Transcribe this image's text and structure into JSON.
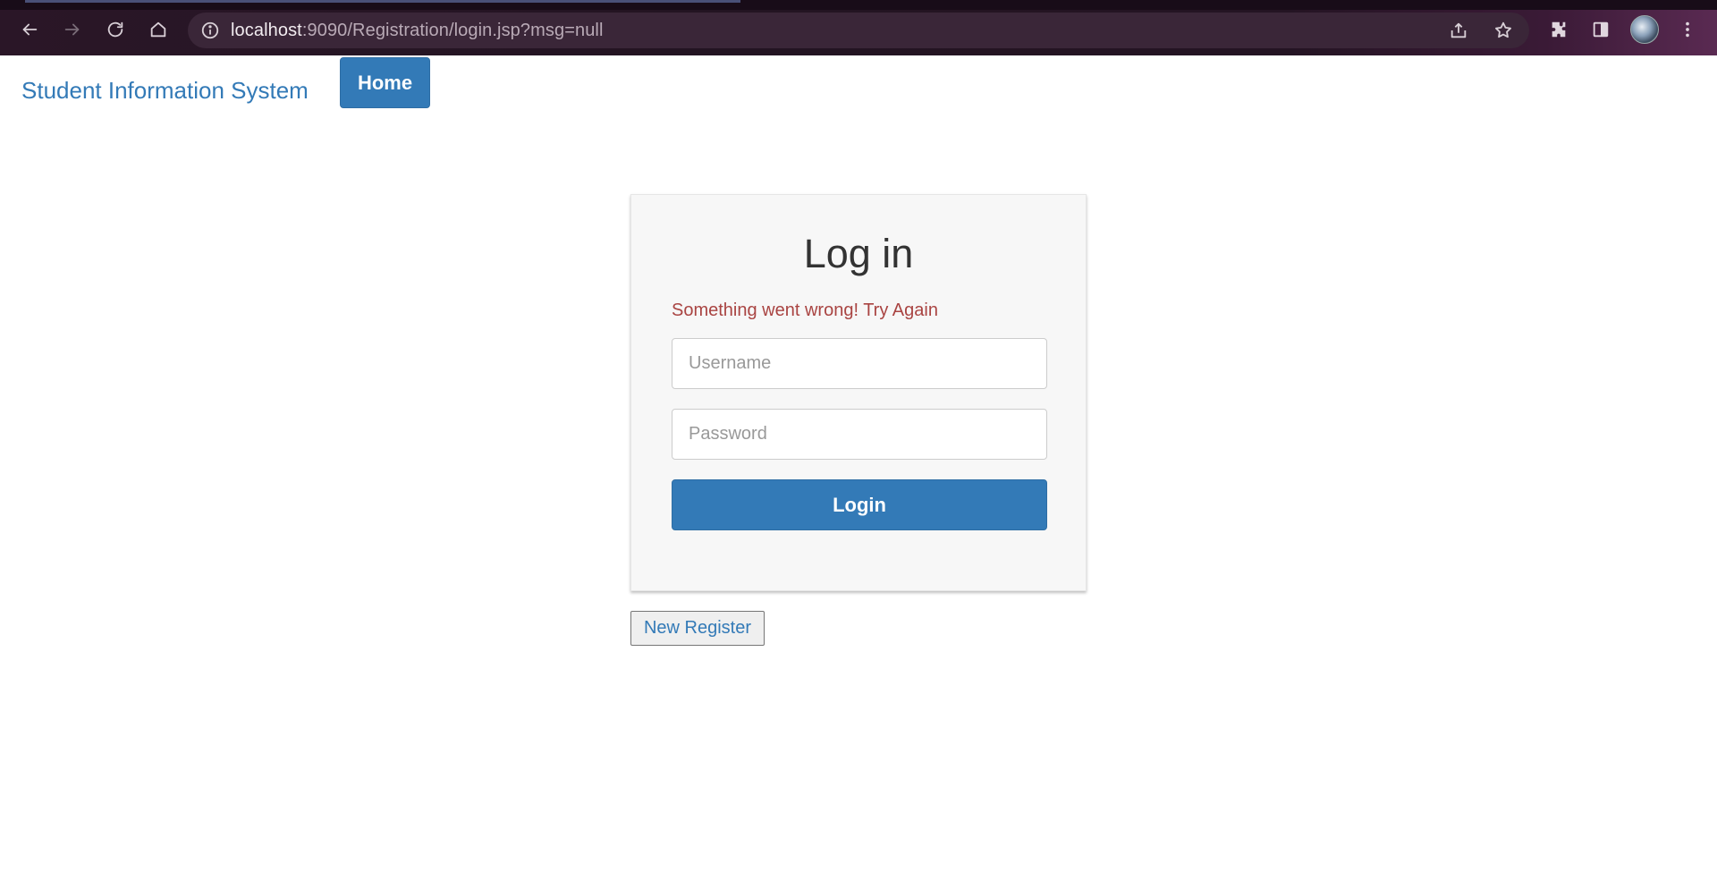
{
  "browser": {
    "url_host": "localhost",
    "url_rest": ":9090/Registration/login.jsp?msg=null"
  },
  "navbar": {
    "brand": "Student Information System",
    "home_label": "Home"
  },
  "login": {
    "title": "Log in",
    "error_message": "Something went wrong! Try Again",
    "username_placeholder": "Username",
    "password_placeholder": "Password",
    "login_label": "Login"
  },
  "register": {
    "label": "New Register"
  },
  "colors": {
    "primary": "#337ab7",
    "error": "#a94442",
    "card_bg": "#f7f7f7"
  }
}
